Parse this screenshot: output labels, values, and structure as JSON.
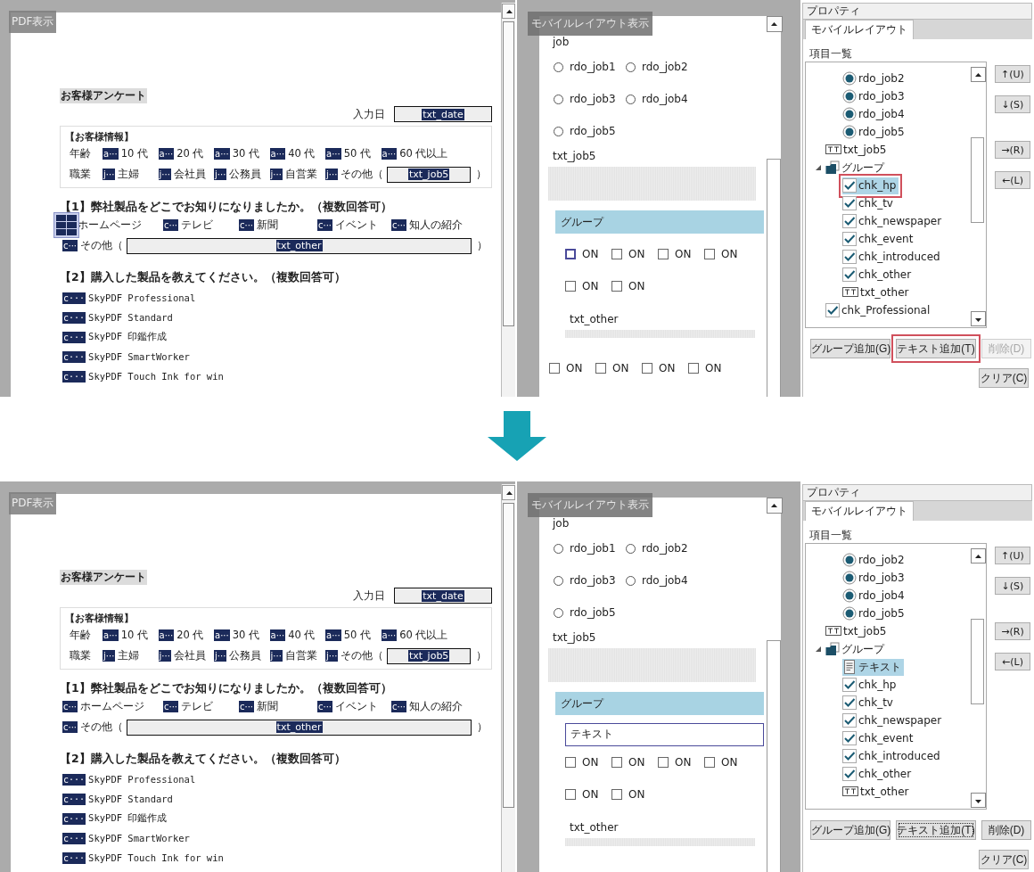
{
  "screens": [
    {
      "pdf": {
        "title": "PDF表示",
        "form_title": "お客様アンケート",
        "date": {
          "label": "入力日",
          "field": "txt_date"
        },
        "info": {
          "heading": "【お客様情報】",
          "rows": [
            {
              "label": "年齢",
              "options": [
                {
                  "marker": "a···",
                  "text": "10 代"
                },
                {
                  "marker": "a···",
                  "text": "20 代"
                },
                {
                  "marker": "a···",
                  "text": "30 代"
                },
                {
                  "marker": "a···",
                  "text": "40 代"
                },
                {
                  "marker": "a···",
                  "text": "50 代"
                },
                {
                  "marker": "a···",
                  "text": "60 代以上"
                }
              ]
            },
            {
              "label": "職業",
              "options": [
                {
                  "marker": "j···",
                  "text": "主婦"
                },
                {
                  "marker": "j···",
                  "text": "会社員"
                },
                {
                  "marker": "j···",
                  "text": "公務員"
                },
                {
                  "marker": "j···",
                  "text": "自営業"
                },
                {
                  "marker": "j···",
                  "text": "その他（"
                }
              ],
              "field": "txt_job5",
              "close": "）"
            }
          ]
        },
        "q1": {
          "heading": "【1】弊社製品をどこでお知りになりましたか。（複数回答可）",
          "options": [
            {
              "drag_icon": true,
              "text": "ホームページ"
            },
            {
              "drag_icon": false,
              "marker": "c···",
              "text": "テレビ"
            },
            {
              "drag_icon": false,
              "marker": "c···",
              "text": "新聞"
            },
            {
              "drag_icon": false,
              "marker": "c···",
              "text": "イベント"
            },
            {
              "drag_icon": false,
              "marker": "c···",
              "text": "知人の紹介"
            }
          ],
          "other": {
            "marker": "c···",
            "text": "その他（",
            "field": "txt_other",
            "close": "）"
          }
        },
        "q2": {
          "heading": "【2】購入した製品を教えてください。（複数回答可）",
          "products": [
            {
              "marker": "c···",
              "text": "SkyPDF Professional"
            },
            {
              "marker": "c···",
              "text": "SkyPDF Standard"
            },
            {
              "marker": "c···",
              "text": "SkyPDF 印鑑作成"
            },
            {
              "marker": "c···",
              "text": "SkyPDF SmartWorker"
            },
            {
              "marker": "c···",
              "text": "SkyPDF Touch Ink for win"
            }
          ]
        }
      },
      "mobile": {
        "title": "モバイルレイアウト表示",
        "items": [
          {
            "kind": "label",
            "text": "job"
          },
          {
            "kind": "radios",
            "options": [
              {
                "label": "rdo_job1",
                "selected": false
              },
              {
                "label": "rdo_job2",
                "selected": false
              }
            ]
          },
          {
            "kind": "radios",
            "options": [
              {
                "label": "rdo_job3",
                "selected": false
              },
              {
                "label": "rdo_job4",
                "selected": false
              }
            ]
          },
          {
            "kind": "radios",
            "options": [
              {
                "label": "rdo_job5",
                "selected": false
              }
            ]
          },
          {
            "kind": "label",
            "text": "txt_job5"
          },
          {
            "kind": "textarea"
          },
          {
            "kind": "group",
            "text": "グループ",
            "children": [
              {
                "kind": "checks",
                "options": [
                  {
                    "label": "ON",
                    "checked": false,
                    "focused": true
                  },
                  {
                    "label": "ON",
                    "checked": false,
                    "focused": false
                  },
                  {
                    "label": "ON",
                    "checked": false,
                    "focused": false
                  },
                  {
                    "label": "ON",
                    "checked": false,
                    "focused": false
                  }
                ]
              },
              {
                "kind": "checks",
                "options": [
                  {
                    "label": "ON",
                    "checked": false,
                    "focused": false
                  },
                  {
                    "label": "ON",
                    "checked": false,
                    "focused": false
                  }
                ]
              },
              {
                "kind": "label",
                "text": "txt_other"
              },
              {
                "kind": "strip"
              }
            ]
          },
          {
            "kind": "checks",
            "options": [
              {
                "label": "ON",
                "checked": false,
                "focused": false
              },
              {
                "label": "ON",
                "checked": false,
                "focused": false
              },
              {
                "label": "ON",
                "checked": false,
                "focused": false
              },
              {
                "label": "ON",
                "checked": false,
                "focused": false
              }
            ]
          }
        ]
      },
      "props": {
        "title": "プロパティ",
        "tab": "モバイルレイアウト",
        "list_label": "項目一覧",
        "tree": [
          {
            "kind": "radio",
            "label": "rdo_job2",
            "selected": false,
            "highlighted": false
          },
          {
            "kind": "radio",
            "label": "rdo_job3",
            "selected": false,
            "highlighted": false
          },
          {
            "kind": "radio",
            "label": "rdo_job4",
            "selected": false,
            "highlighted": false
          },
          {
            "kind": "radio",
            "label": "rdo_job5",
            "selected": false,
            "highlighted": false
          },
          {
            "kind": "text",
            "label": "txt_job5",
            "selected": false,
            "highlighted": false
          },
          {
            "kind": "group",
            "label": "グループ",
            "selected": false,
            "highlighted": false,
            "expanded": true,
            "children": [
              {
                "kind": "check",
                "label": "chk_hp",
                "selected": true,
                "highlighted": true
              },
              {
                "kind": "check",
                "label": "chk_tv",
                "selected": false,
                "highlighted": false
              },
              {
                "kind": "check",
                "label": "chk_newspaper",
                "selected": false,
                "highlighted": false
              },
              {
                "kind": "check",
                "label": "chk_event",
                "selected": false,
                "highlighted": false
              },
              {
                "kind": "check",
                "label": "chk_introduced",
                "selected": false,
                "highlighted": false
              },
              {
                "kind": "check",
                "label": "chk_other",
                "selected": false,
                "highlighted": false
              },
              {
                "kind": "text",
                "label": "txt_other",
                "selected": false,
                "highlighted": false
              }
            ]
          },
          {
            "kind": "check",
            "label": "chk_Professional",
            "selected": false,
            "highlighted": false
          }
        ],
        "move_buttons": [
          "↑(U)",
          "↓(S)",
          "→(R)",
          "←(L)"
        ],
        "buttons": [
          {
            "label": "グループ追加(G)",
            "disabled": false,
            "focused": false,
            "highlighted": false
          },
          {
            "label": "テキスト追加(T)",
            "disabled": false,
            "focused": false,
            "highlighted": true
          },
          {
            "label": "削除(D)",
            "disabled": true,
            "focused": false,
            "highlighted": false
          },
          {
            "label": "クリア(C)",
            "disabled": false,
            "focused": false,
            "highlighted": false
          }
        ]
      }
    },
    {
      "pdf": {
        "title": "PDF表示",
        "form_title": "お客様アンケート",
        "date": {
          "label": "入力日",
          "field": "txt_date"
        },
        "info": {
          "heading": "【お客様情報】",
          "rows": [
            {
              "label": "年齢",
              "options": [
                {
                  "marker": "a···",
                  "text": "10 代"
                },
                {
                  "marker": "a···",
                  "text": "20 代"
                },
                {
                  "marker": "a···",
                  "text": "30 代"
                },
                {
                  "marker": "a···",
                  "text": "40 代"
                },
                {
                  "marker": "a···",
                  "text": "50 代"
                },
                {
                  "marker": "a···",
                  "text": "60 代以上"
                }
              ]
            },
            {
              "label": "職業",
              "options": [
                {
                  "marker": "j···",
                  "text": "主婦"
                },
                {
                  "marker": "j···",
                  "text": "会社員"
                },
                {
                  "marker": "j···",
                  "text": "公務員"
                },
                {
                  "marker": "j···",
                  "text": "自営業"
                },
                {
                  "marker": "j···",
                  "text": "その他（"
                }
              ],
              "field": "txt_job5",
              "close": "）"
            }
          ]
        },
        "q1": {
          "heading": "【1】弊社製品をどこでお知りになりましたか。（複数回答可）",
          "options": [
            {
              "drag_icon": false,
              "marker": "c···",
              "text": "ホームページ"
            },
            {
              "drag_icon": false,
              "marker": "c···",
              "text": "テレビ"
            },
            {
              "drag_icon": false,
              "marker": "c···",
              "text": "新聞"
            },
            {
              "drag_icon": false,
              "marker": "c···",
              "text": "イベント"
            },
            {
              "drag_icon": false,
              "marker": "c···",
              "text": "知人の紹介"
            }
          ],
          "other": {
            "marker": "c···",
            "text": "その他（",
            "field": "txt_other",
            "close": "）"
          }
        },
        "q2": {
          "heading": "【2】購入した製品を教えてください。（複数回答可）",
          "products": [
            {
              "marker": "c···",
              "text": "SkyPDF Professional"
            },
            {
              "marker": "c···",
              "text": "SkyPDF Standard"
            },
            {
              "marker": "c···",
              "text": "SkyPDF 印鑑作成"
            },
            {
              "marker": "c···",
              "text": "SkyPDF SmartWorker"
            },
            {
              "marker": "c···",
              "text": "SkyPDF Touch Ink for win"
            }
          ]
        }
      },
      "mobile": {
        "title": "モバイルレイアウト表示",
        "items": [
          {
            "kind": "label",
            "text": "job"
          },
          {
            "kind": "radios",
            "options": [
              {
                "label": "rdo_job1",
                "selected": false
              },
              {
                "label": "rdo_job2",
                "selected": false
              }
            ]
          },
          {
            "kind": "radios",
            "options": [
              {
                "label": "rdo_job3",
                "selected": false
              },
              {
                "label": "rdo_job4",
                "selected": false
              }
            ]
          },
          {
            "kind": "radios",
            "options": [
              {
                "label": "rdo_job5",
                "selected": false
              }
            ]
          },
          {
            "kind": "label",
            "text": "txt_job5"
          },
          {
            "kind": "textarea"
          },
          {
            "kind": "group",
            "text": "グループ",
            "children": [
              {
                "kind": "text_field",
                "value": "テキスト"
              },
              {
                "kind": "checks",
                "options": [
                  {
                    "label": "ON",
                    "checked": false,
                    "focused": false
                  },
                  {
                    "label": "ON",
                    "checked": false,
                    "focused": false
                  },
                  {
                    "label": "ON",
                    "checked": false,
                    "focused": false
                  },
                  {
                    "label": "ON",
                    "checked": false,
                    "focused": false
                  }
                ]
              },
              {
                "kind": "checks",
                "options": [
                  {
                    "label": "ON",
                    "checked": false,
                    "focused": false
                  },
                  {
                    "label": "ON",
                    "checked": false,
                    "focused": false
                  }
                ]
              },
              {
                "kind": "label",
                "text": "txt_other"
              },
              {
                "kind": "strip"
              }
            ]
          }
        ]
      },
      "props": {
        "title": "プロパティ",
        "tab": "モバイルレイアウト",
        "list_label": "項目一覧",
        "tree": [
          {
            "kind": "radio",
            "label": "rdo_job2",
            "selected": false,
            "highlighted": false
          },
          {
            "kind": "radio",
            "label": "rdo_job3",
            "selected": false,
            "highlighted": false
          },
          {
            "kind": "radio",
            "label": "rdo_job4",
            "selected": false,
            "highlighted": false
          },
          {
            "kind": "radio",
            "label": "rdo_job5",
            "selected": false,
            "highlighted": false
          },
          {
            "kind": "text",
            "label": "txt_job5",
            "selected": false,
            "highlighted": false
          },
          {
            "kind": "group",
            "label": "グループ",
            "selected": false,
            "highlighted": false,
            "expanded": true,
            "children": [
              {
                "kind": "doc",
                "label": "テキスト",
                "selected": true,
                "highlighted": false
              },
              {
                "kind": "check",
                "label": "chk_hp",
                "selected": false,
                "highlighted": false
              },
              {
                "kind": "check",
                "label": "chk_tv",
                "selected": false,
                "highlighted": false
              },
              {
                "kind": "check",
                "label": "chk_newspaper",
                "selected": false,
                "highlighted": false
              },
              {
                "kind": "check",
                "label": "chk_event",
                "selected": false,
                "highlighted": false
              },
              {
                "kind": "check",
                "label": "chk_introduced",
                "selected": false,
                "highlighted": false
              },
              {
                "kind": "check",
                "label": "chk_other",
                "selected": false,
                "highlighted": false
              },
              {
                "kind": "text",
                "label": "txt_other",
                "selected": false,
                "highlighted": false
              }
            ]
          }
        ],
        "move_buttons": [
          "↑(U)",
          "↓(S)",
          "→(R)",
          "←(L)"
        ],
        "buttons": [
          {
            "label": "グループ追加(G)",
            "disabled": false,
            "focused": false,
            "highlighted": false
          },
          {
            "label": "テキスト追加(T)",
            "disabled": false,
            "focused": true,
            "highlighted": false
          },
          {
            "label": "削除(D)",
            "disabled": false,
            "focused": false,
            "highlighted": false
          },
          {
            "label": "クリア(C)",
            "disabled": false,
            "focused": false,
            "highlighted": false
          }
        ]
      }
    }
  ]
}
